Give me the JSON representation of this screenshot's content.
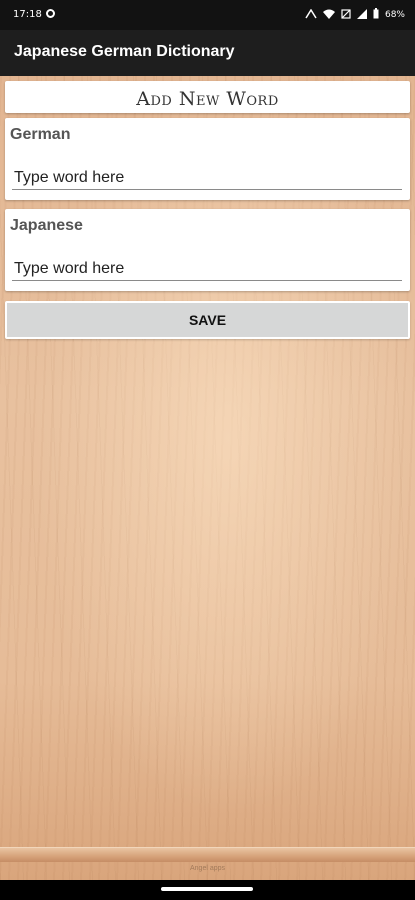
{
  "status_bar": {
    "time": "17:18",
    "battery": "68%",
    "icons": [
      "notification-icon",
      "hotspot-icon",
      "wifi-icon",
      "mute-icon",
      "signal-icon",
      "battery-icon"
    ]
  },
  "app_bar": {
    "title": "Japanese German Dictionary"
  },
  "form": {
    "heading": "Add New Word",
    "german": {
      "label": "German",
      "placeholder": "Type word here"
    },
    "japanese": {
      "label": "Japanese",
      "placeholder": "Type word here"
    },
    "save_label": "SAVE"
  },
  "footer": {
    "shelf_text": "Angel apps"
  },
  "colors": {
    "app_bar": "#1e1e1e",
    "button": "#d6d7d7",
    "wood": "#e6bc98"
  }
}
